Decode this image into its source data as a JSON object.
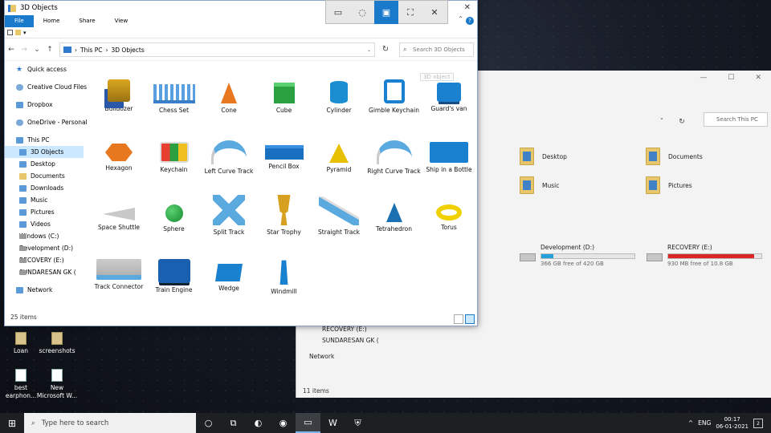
{
  "window": {
    "title": "3D Objects",
    "close": "✕"
  },
  "ribbon": {
    "tabs": [
      "File",
      "Home",
      "Share",
      "View"
    ],
    "help": "?",
    "collapse": "⌃"
  },
  "qat": {
    "dropdown": "▾"
  },
  "nav": {
    "back": "←",
    "forward": "→",
    "recent": "⌄",
    "up": "↑",
    "path": [
      "This PC",
      "3D Objects"
    ],
    "separator": "›",
    "refresh": "↻",
    "search_placeholder": "Search 3D Objects"
  },
  "sidebar": [
    {
      "label": "Quick access",
      "icon": "star-icon",
      "kind": "star"
    },
    {
      "label": "Creative Cloud Files",
      "icon": "cloud-icon",
      "kind": "cloud"
    },
    {
      "label": "Dropbox",
      "icon": "dropbox-icon",
      "kind": "blue"
    },
    {
      "label": "OneDrive - Personal",
      "icon": "onedrive-icon",
      "kind": "cloud"
    },
    {
      "label": "This PC",
      "icon": "pc-icon",
      "kind": "blue"
    },
    {
      "label": "3D Objects",
      "icon": "3d-objects-icon",
      "kind": "blue",
      "sub": true,
      "selected": true
    },
    {
      "label": "Desktop",
      "icon": "desktop-icon",
      "kind": "blue",
      "sub": true
    },
    {
      "label": "Documents",
      "icon": "documents-icon",
      "kind": "folder",
      "sub": true
    },
    {
      "label": "Downloads",
      "icon": "downloads-icon",
      "kind": "blue",
      "sub": true
    },
    {
      "label": "Music",
      "icon": "music-icon",
      "kind": "blue",
      "sub": true
    },
    {
      "label": "Pictures",
      "icon": "pictures-icon",
      "kind": "blue",
      "sub": true
    },
    {
      "label": "Videos",
      "icon": "videos-icon",
      "kind": "blue",
      "sub": true
    },
    {
      "label": "Windows (C:)",
      "icon": "drive-icon",
      "kind": "drive",
      "sub": true
    },
    {
      "label": "Development (D:)",
      "icon": "drive-icon",
      "kind": "drive",
      "sub": true
    },
    {
      "label": "RECOVERY (E:)",
      "icon": "drive-icon",
      "kind": "drive",
      "sub": true
    },
    {
      "label": "SUNDARESAN GK (",
      "icon": "drive-icon",
      "kind": "drive",
      "sub": true
    },
    {
      "label": "Network",
      "icon": "network-icon",
      "kind": "blue"
    }
  ],
  "items": [
    {
      "label": "Bulldozer",
      "thumb": "bull"
    },
    {
      "label": "Chess Set",
      "thumb": "chess"
    },
    {
      "label": "Cone",
      "thumb": "cone"
    },
    {
      "label": "Cube",
      "thumb": "cube"
    },
    {
      "label": "Cylinder",
      "thumb": "cyl"
    },
    {
      "label": "Gimble Keychain",
      "thumb": "gimble"
    },
    {
      "label": "Guard's van",
      "thumb": "van"
    },
    {
      "label": "Hexagon",
      "thumb": "hex"
    },
    {
      "label": "Keychain",
      "thumb": "key"
    },
    {
      "label": "Left Curve Track",
      "thumb": "track"
    },
    {
      "label": "Pencil Box",
      "thumb": "pencil"
    },
    {
      "label": "Pyramid",
      "thumb": "pyr"
    },
    {
      "label": "Right Curve Track",
      "thumb": "track r"
    },
    {
      "label": "Ship in a Bottle",
      "thumb": "ship"
    },
    {
      "label": "Space Shuttle",
      "thumb": "shuttle"
    },
    {
      "label": "Sphere",
      "thumb": "sphere"
    },
    {
      "label": "Split Track",
      "thumb": "split"
    },
    {
      "label": "Star Trophy",
      "thumb": "trophy"
    },
    {
      "label": "Straight Track",
      "thumb": "straight"
    },
    {
      "label": "Tetrahedron",
      "thumb": "tetra"
    },
    {
      "label": "Torus",
      "thumb": "torus"
    },
    {
      "label": "Track Connector",
      "thumb": "conn"
    },
    {
      "label": "Train Engine",
      "thumb": "train"
    },
    {
      "label": "Wedge",
      "thumb": "wedge"
    },
    {
      "label": "Windmill",
      "thumb": "mill"
    }
  ],
  "tooltip": "3D object",
  "status": "25 items",
  "snip_toolbar": [
    "rectangle-snip-icon",
    "freeform-snip-icon",
    "window-snip-icon",
    "fullscreen-snip-icon",
    "close-icon"
  ],
  "bg_window": {
    "controls": [
      "—",
      "☐",
      "✕"
    ],
    "nav_recent": "⌄",
    "refresh": "↻",
    "search_placeholder": "Search This PC",
    "folders": [
      "Desktop",
      "Documents",
      "Music",
      "Pictures"
    ],
    "drives": [
      {
        "name": "Development (D:)",
        "free": "366 GB free of 420 GB",
        "used_fraction": 0.13
      },
      {
        "name": "RECOVERY (E:)",
        "free": "930 MB free of 10.8 GB",
        "used_fraction": 0.92
      }
    ],
    "nav": [
      "RECOVERY (E:)",
      "SUNDARESAN GK (",
      "Network"
    ],
    "status": "11 items"
  },
  "desktop_icons": [
    {
      "label": "Loan",
      "kind": "folder"
    },
    {
      "label": "screenshots",
      "kind": "folder"
    },
    {
      "label": "best earphon...",
      "kind": "doc"
    },
    {
      "label": "New Microsoft W...",
      "kind": "doc"
    }
  ],
  "taskbar": {
    "start": "⊞",
    "search_placeholder": "Type here to search",
    "apps": [
      "task-view-icon",
      "multitasking-icon",
      "firefox-icon",
      "chrome-icon",
      "file-explorer-icon",
      "word-icon",
      "security-icon"
    ],
    "app_glyphs": [
      "○",
      "⧉",
      "◐",
      "◉",
      "▭",
      "W",
      "⛨"
    ],
    "tray_chevron": "^",
    "lang": "ENG",
    "time": "00:17",
    "date": "06-01-2021",
    "notifications": "2"
  }
}
